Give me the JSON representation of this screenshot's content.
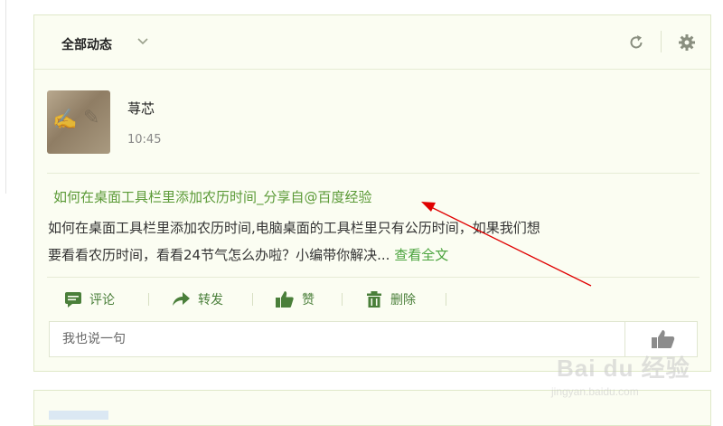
{
  "feed": {
    "filter_label": "全部动态",
    "icons": [
      "chevron-down-icon",
      "refresh-icon",
      "settings-gear-icon"
    ]
  },
  "post": {
    "author": "荨芯",
    "time": "10:45",
    "title": "如何在桌面工具栏里添加农历时间_分享自@百度经验",
    "body_line1": "如何在桌面工具栏里添加农历时间,电脑桌面的工具栏里只有公历时间，如果我们想",
    "body_line2": "要看看农历时间，看看24节气怎么办啦？小编带你解决...",
    "read_more": "查看全文"
  },
  "actions": {
    "comment": "评论",
    "forward": "转发",
    "like": "赞",
    "delete": "删除"
  },
  "comment_box": {
    "placeholder": "我也说一句"
  },
  "watermark": {
    "brand": "Bai du 经验",
    "url": "jingyan.baidu.com"
  },
  "colors": {
    "card_bg": "#fbfdf2",
    "link_green": "#5b9a37",
    "action_green": "#4a7f3a",
    "annotation_red": "#e00000"
  }
}
